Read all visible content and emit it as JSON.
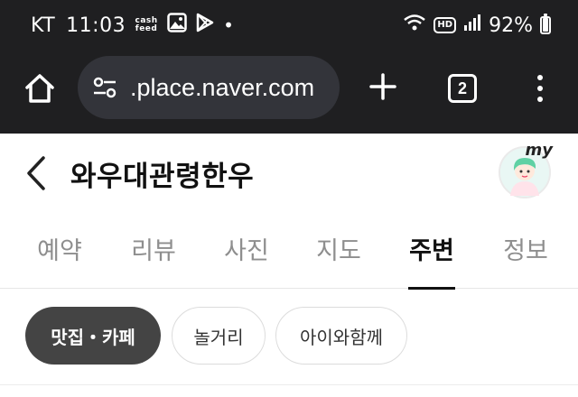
{
  "status_bar": {
    "carrier": "KT",
    "time": "11:03",
    "cashfeed_top": "cash",
    "cashfeed_bottom": "feed",
    "dot": "•",
    "hd": "HD",
    "battery_percent": "92%",
    "battery_level": 0.92,
    "icons": [
      "cashfeed-icon",
      "gallery-icon",
      "play-store-icon",
      "wifi-icon",
      "hd-icon",
      "signal-icon",
      "battery-icon"
    ]
  },
  "browser": {
    "url": ".place.naver.com",
    "tab_count": "2",
    "icons": [
      "home-icon",
      "tune-icon",
      "plus-icon",
      "tabs-icon",
      "more-vert-icon"
    ]
  },
  "header": {
    "title": "와우대관령한우",
    "my_label": "my",
    "icons": [
      "back-arrow-icon",
      "avatar"
    ]
  },
  "tabs": [
    {
      "label": "예약",
      "active": false
    },
    {
      "label": "리뷰",
      "active": false
    },
    {
      "label": "사진",
      "active": false
    },
    {
      "label": "지도",
      "active": false
    },
    {
      "label": "주변",
      "active": true
    },
    {
      "label": "정보",
      "active": false
    }
  ],
  "chips": [
    {
      "label": "맛집・카페",
      "selected": true
    },
    {
      "label": "놀거리",
      "selected": false
    },
    {
      "label": "아이와함께",
      "selected": false
    }
  ],
  "colors": {
    "chrome_bg": "#1f1f21",
    "urlbar_bg": "#33343a",
    "active_tab": "#111111",
    "inactive_tab": "#8e8e8e",
    "chip_selected_bg": "#444444"
  }
}
